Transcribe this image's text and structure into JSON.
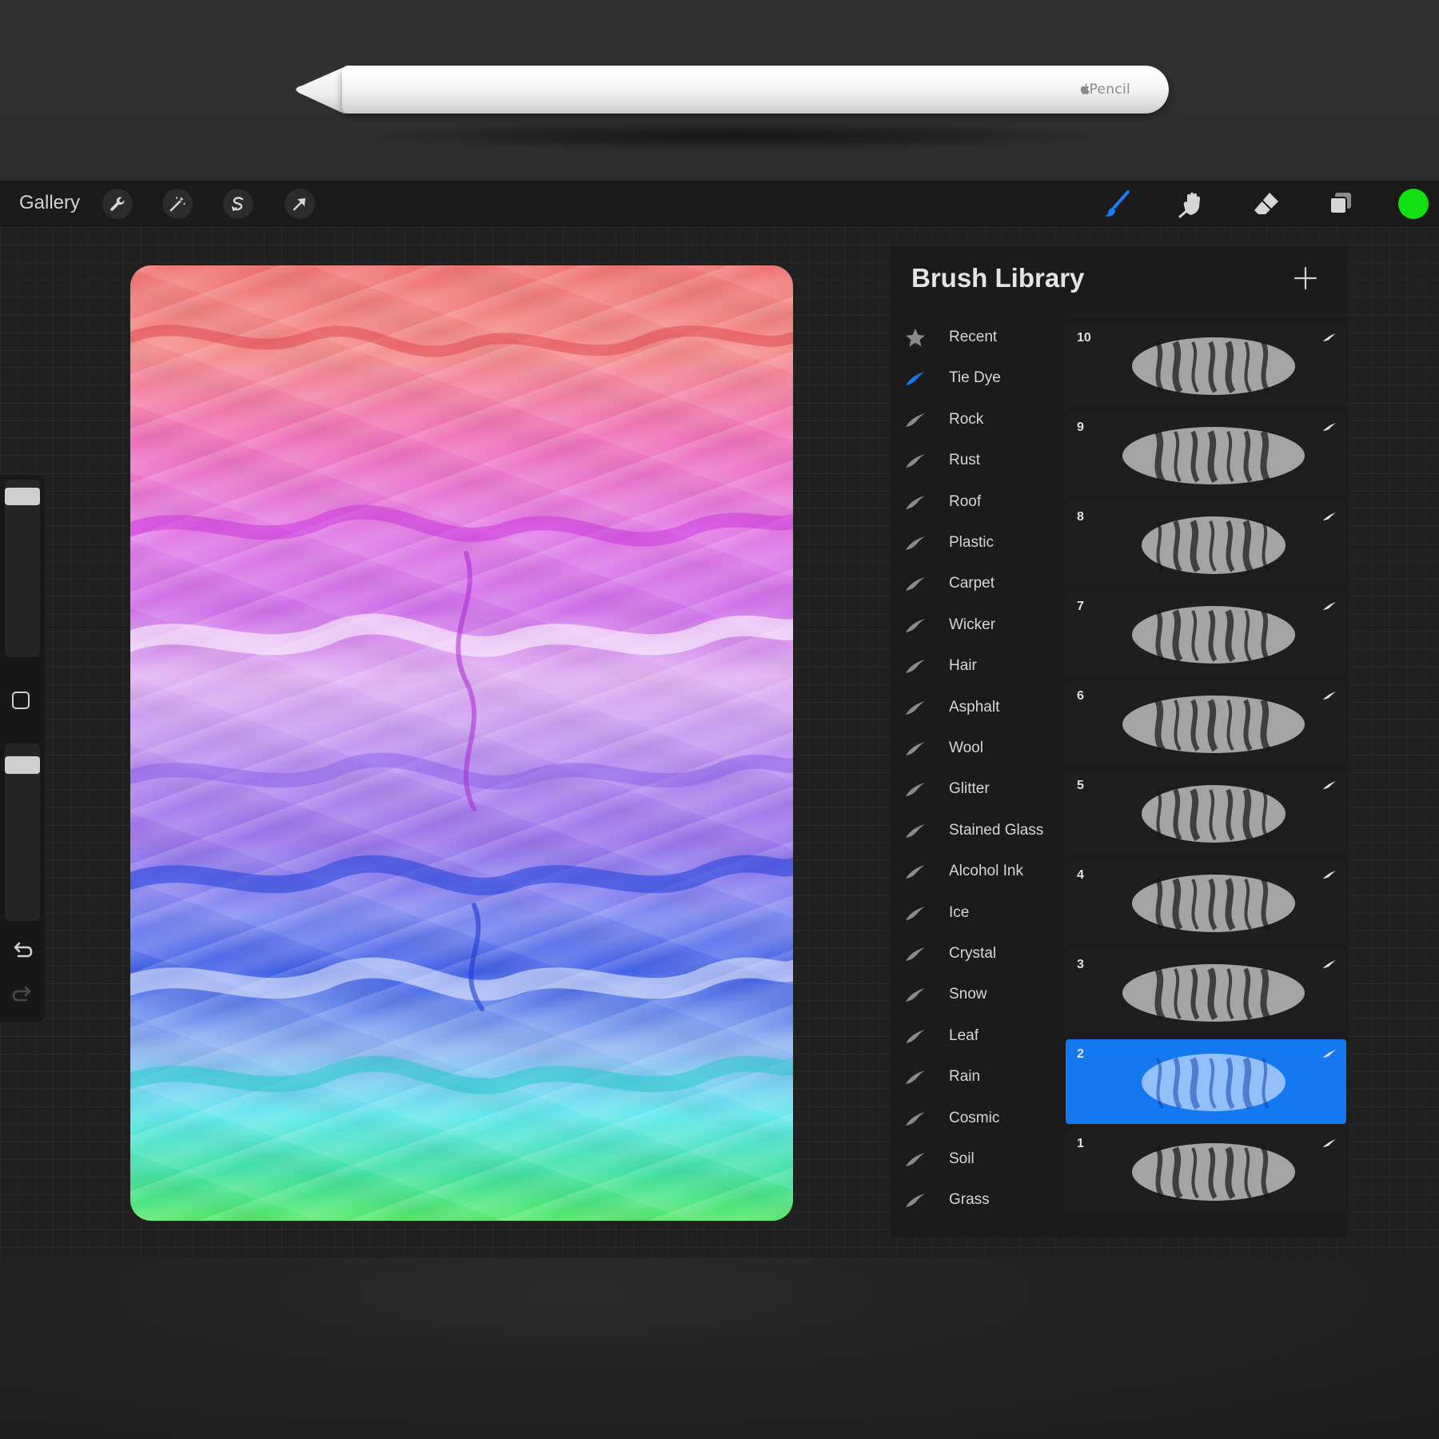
{
  "pencil": {
    "label": "Pencil",
    "brand": "apple-logo-icon"
  },
  "toolbar": {
    "gallery_label": "Gallery",
    "left_tools": [
      "wrench-icon",
      "magic-wand-icon",
      "selection-icon",
      "move-arrow-icon"
    ],
    "right_tools": [
      "paintbrush-icon",
      "smudge-icon",
      "eraser-icon",
      "layers-icon"
    ],
    "current_color": "#10e010"
  },
  "sidebar": {
    "brush_size": 0.95,
    "opacity": 0.92,
    "undo_icon": "undo-icon",
    "redo_icon": "redo-icon"
  },
  "library": {
    "title": "Brush Library",
    "add_icon": "plus-icon",
    "sets": [
      {
        "label": "Recent",
        "icon": "star-icon",
        "active": false
      },
      {
        "label": "Tie Dye",
        "icon": "brush-stroke-icon",
        "active": true
      },
      {
        "label": "Rock",
        "icon": "brush-stroke-icon",
        "active": false
      },
      {
        "label": "Rust",
        "icon": "brush-stroke-icon",
        "active": false
      },
      {
        "label": "Roof",
        "icon": "brush-stroke-icon",
        "active": false
      },
      {
        "label": "Plastic",
        "icon": "brush-stroke-icon",
        "active": false
      },
      {
        "label": "Carpet",
        "icon": "brush-stroke-icon",
        "active": false
      },
      {
        "label": "Wicker",
        "icon": "brush-stroke-icon",
        "active": false
      },
      {
        "label": "Hair",
        "icon": "brush-stroke-icon",
        "active": false
      },
      {
        "label": "Asphalt",
        "icon": "brush-stroke-icon",
        "active": false
      },
      {
        "label": "Wool",
        "icon": "brush-stroke-icon",
        "active": false
      },
      {
        "label": "Glitter",
        "icon": "brush-stroke-icon",
        "active": false
      },
      {
        "label": "Stained Glass",
        "icon": "brush-stroke-icon",
        "active": false
      },
      {
        "label": "Alcohol Ink",
        "icon": "brush-stroke-icon",
        "active": false
      },
      {
        "label": "Ice",
        "icon": "brush-stroke-icon",
        "active": false
      },
      {
        "label": "Crystal",
        "icon": "brush-stroke-icon",
        "active": false
      },
      {
        "label": "Snow",
        "icon": "brush-stroke-icon",
        "active": false
      },
      {
        "label": "Leaf",
        "icon": "brush-stroke-icon",
        "active": false
      },
      {
        "label": "Rain",
        "icon": "brush-stroke-icon",
        "active": false
      },
      {
        "label": "Cosmic",
        "icon": "brush-stroke-icon",
        "active": false
      },
      {
        "label": "Soil",
        "icon": "brush-stroke-icon",
        "active": false
      },
      {
        "label": "Grass",
        "icon": "brush-stroke-icon",
        "active": false
      }
    ],
    "brushes": [
      {
        "label": "",
        "selected": false
      },
      {
        "label": "10",
        "selected": false
      },
      {
        "label": "9",
        "selected": false
      },
      {
        "label": "8",
        "selected": false
      },
      {
        "label": "7",
        "selected": false
      },
      {
        "label": "6",
        "selected": false
      },
      {
        "label": "5",
        "selected": false
      },
      {
        "label": "4",
        "selected": false
      },
      {
        "label": "3",
        "selected": false
      },
      {
        "label": "2",
        "selected": true
      },
      {
        "label": "1",
        "selected": false
      }
    ]
  },
  "colors": {
    "accent": "#1478f0",
    "panel": "#1b1b1b",
    "toolbar": "#1a1a1a"
  }
}
